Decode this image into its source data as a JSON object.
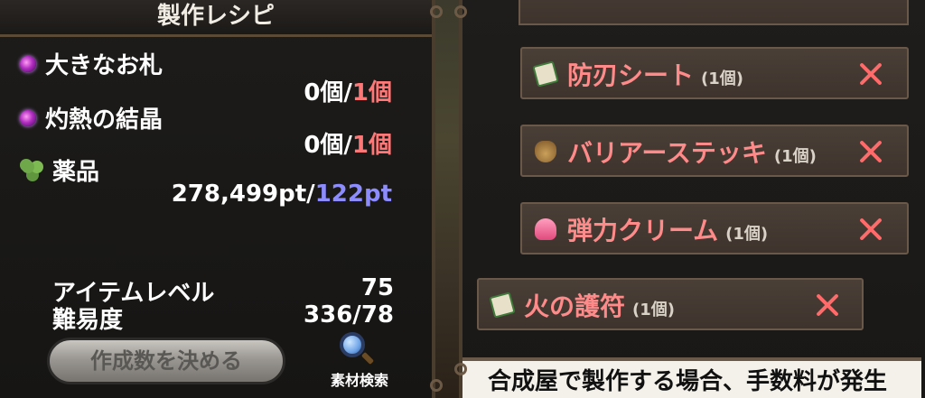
{
  "left_panel": {
    "title": "製作レシピ",
    "materials": [
      {
        "name": "大きなお札",
        "have": "0個/",
        "need": "1個",
        "icon": "purple-orb-icon"
      },
      {
        "name": "灼熱の結晶",
        "have": "0個/",
        "need": "1個",
        "icon": "purple-orb-icon"
      },
      {
        "name": "薬品",
        "have": "278,499pt/",
        "need": "122pt",
        "icon": "herb-icon"
      }
    ],
    "item_level": {
      "label": "アイテムレベル",
      "value": "75"
    },
    "difficulty": {
      "label": "難易度",
      "value": "336/",
      "need": "78"
    },
    "decide_button": "作成数を決める",
    "search_label": "素材検索"
  },
  "right_panel": {
    "items": [
      {
        "name": "防刃シート",
        "count": "(1個)",
        "icon": "scroll-icon"
      },
      {
        "name": "バリアーステッキ",
        "count": "(1個)",
        "icon": "pouch-icon"
      },
      {
        "name": "弾力クリーム",
        "count": "(1個)",
        "icon": "cream-icon"
      },
      {
        "name": "火の護符",
        "count": "(1個)",
        "icon": "scroll-icon"
      }
    ],
    "bottom_message": "合成屋で製作する場合、手数料が発生"
  },
  "colors": {
    "need_red": "#ff7878",
    "need_blue": "#8c8cff",
    "item_name": "#ff8a8a"
  }
}
